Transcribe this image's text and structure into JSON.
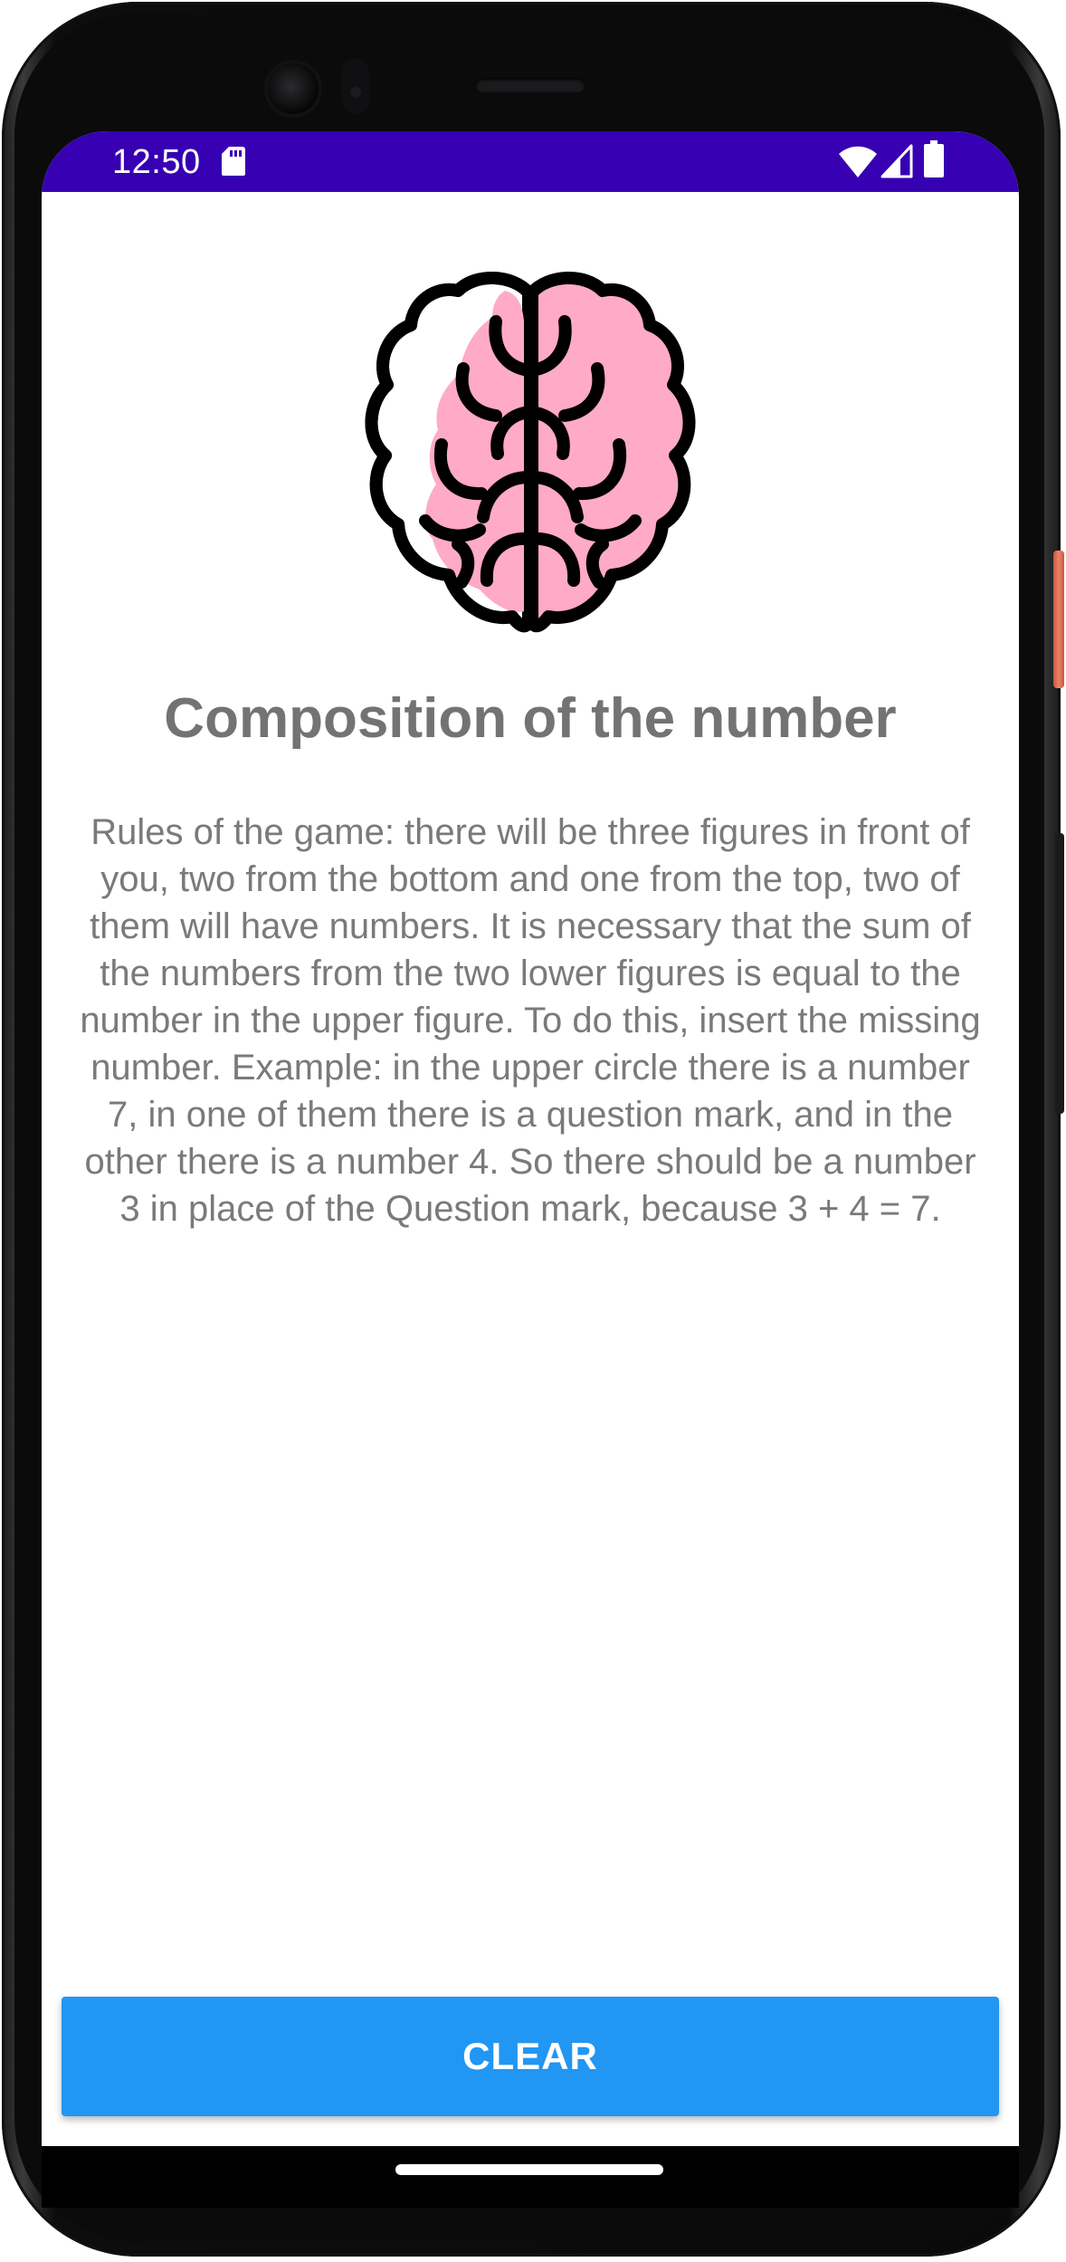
{
  "status_bar": {
    "time": "12:50",
    "color": "#3700b3",
    "icons": [
      "sd-card-icon",
      "wifi-icon",
      "cell-signal-icon",
      "battery-icon"
    ]
  },
  "content": {
    "icon": "brain-icon",
    "title": "Composition of the number",
    "rules": "Rules of the game: there will be three figures in front of you, two from the bottom and one from the top, two of them will have numbers. It is necessary that the sum of the numbers from the two lower figures is equal to the number in the upper figure. To do this, insert the missing number. Example: in the upper circle there is a number 7, in one of them there is a question mark, and in the other there is a number 4. So there should be a number 3 in place of the Question mark, because 3 + 4 = 7."
  },
  "actions": {
    "clear_label": "CLEAR",
    "clear_color": "#2196f3"
  },
  "colors": {
    "brain_pink": "#ffaac6",
    "text_gray": "#737373"
  }
}
